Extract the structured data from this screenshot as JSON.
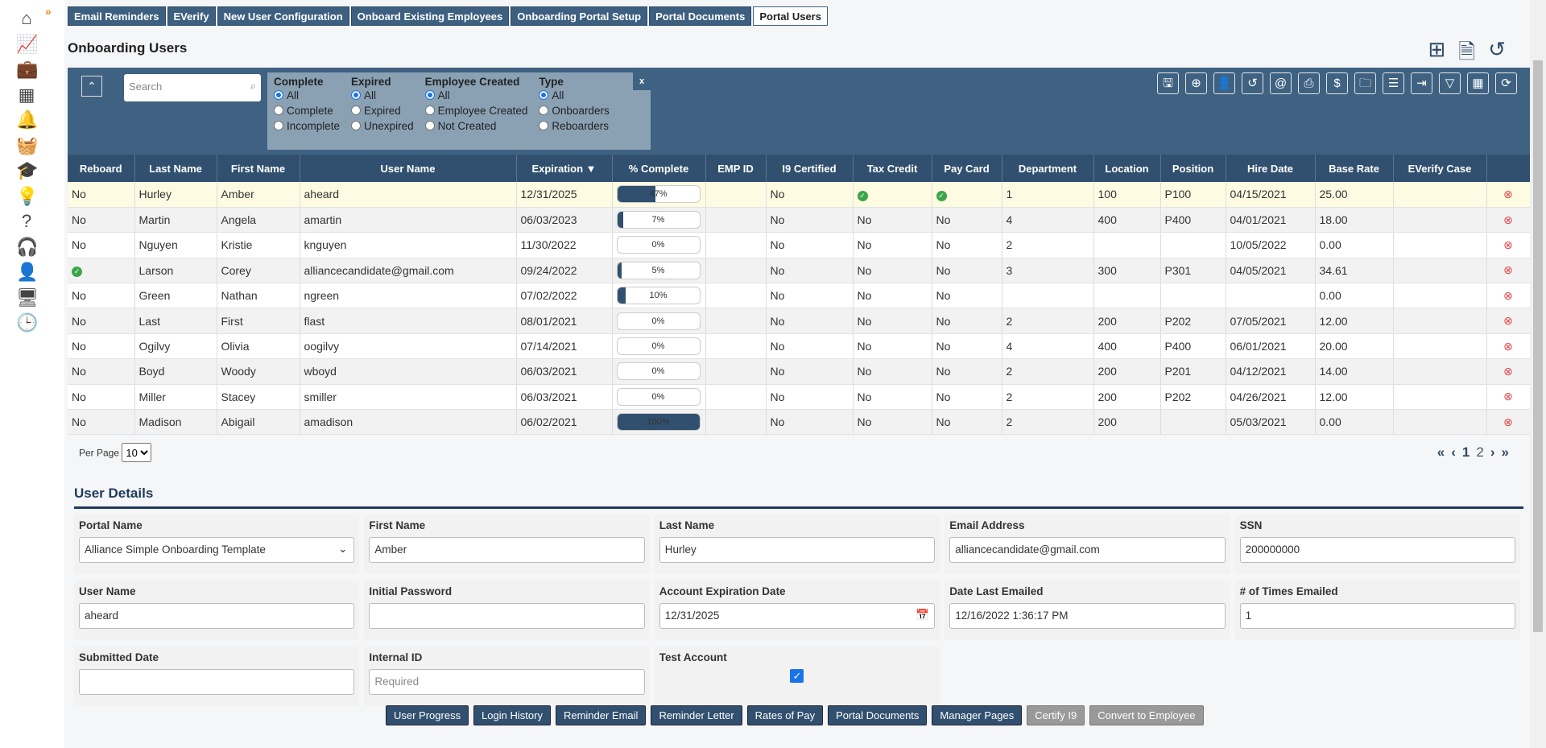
{
  "sidebar": {
    "icons": [
      "home-icon",
      "chart-icon",
      "briefcase-icon",
      "building-icon",
      "bell-icon",
      "basket-icon",
      "graduation-cap-icon",
      "lightbulb-icon",
      "help-icon",
      "headset-icon",
      "person-icon",
      "monitor-icon",
      "clock-icon"
    ],
    "glyphs": [
      "⌂",
      "📈",
      "💼",
      "▦",
      "🔔",
      "🧺",
      "🎓",
      "💡",
      "?",
      "🎧",
      "👤",
      "🖥",
      "🕒"
    ],
    "expand": "»"
  },
  "tabs": [
    "Email Reminders",
    "EVerify",
    "New User Configuration",
    "Onboard Existing Employees",
    "Onboarding Portal Setup",
    "Portal Documents",
    "Portal Users"
  ],
  "active_tab": "Portal Users",
  "page_title": "Onboarding Users",
  "search": {
    "placeholder": "Search"
  },
  "filters": [
    {
      "title": "Complete",
      "options": [
        "All",
        "Complete",
        "Incomplete"
      ],
      "selected": "All"
    },
    {
      "title": "Expired",
      "options": [
        "All",
        "Expired",
        "Unexpired"
      ],
      "selected": "All"
    },
    {
      "title": "Employee Created",
      "options": [
        "All",
        "Employee Created",
        "Not Created"
      ],
      "selected": "All"
    },
    {
      "title": "Type",
      "options": [
        "All",
        "Onboarders",
        "Reboarders"
      ],
      "selected": "All"
    }
  ],
  "filter_close": "x",
  "tools": [
    "save-icon",
    "add-icon",
    "user-card-icon",
    "history-icon",
    "email-at-icon",
    "pdf-icon",
    "invoice-icon",
    "folders-icon",
    "checklist-icon",
    "export-icon",
    "filter-icon",
    "grid-icon",
    "refresh-icon"
  ],
  "table": {
    "columns": [
      "Reboard",
      "Last Name",
      "First Name",
      "User Name",
      "Expiration ▼",
      "% Complete",
      "EMP ID",
      "I9 Certified",
      "Tax Credit",
      "Pay Card",
      "Department",
      "Location",
      "Position",
      "Hire Date",
      "Base Rate",
      "EVerify Case",
      ""
    ],
    "rows": [
      [
        "No",
        "Hurley",
        "Amber",
        "aheard",
        "12/31/2025",
        47,
        "",
        "No",
        "✓",
        "✓",
        "1",
        "100",
        "P100",
        "04/15/2021",
        "25.00",
        ""
      ],
      [
        "No",
        "Martin",
        "Angela",
        "amartin",
        "06/03/2023",
        7,
        "",
        "No",
        "No",
        "No",
        "4",
        "400",
        "P400",
        "04/01/2021",
        "18.00",
        ""
      ],
      [
        "No",
        "Nguyen",
        "Kristie",
        "knguyen",
        "11/30/2022",
        0,
        "",
        "No",
        "No",
        "No",
        "2",
        "",
        "",
        "10/05/2022",
        "0.00",
        ""
      ],
      [
        "✓",
        "Larson",
        "Corey",
        "alliancecandidate@gmail.com",
        "09/24/2022",
        5,
        "",
        "No",
        "No",
        "No",
        "3",
        "300",
        "P301",
        "04/05/2021",
        "34.61",
        ""
      ],
      [
        "No",
        "Green",
        "Nathan",
        "ngreen",
        "07/02/2022",
        10,
        "",
        "No",
        "No",
        "No",
        "",
        "",
        "",
        "",
        "0.00",
        ""
      ],
      [
        "No",
        "Last",
        "First",
        "flast",
        "08/01/2021",
        0,
        "",
        "No",
        "No",
        "No",
        "2",
        "200",
        "P202",
        "07/05/2021",
        "12.00",
        ""
      ],
      [
        "No",
        "Ogilvy",
        "Olivia",
        "oogilvy",
        "07/14/2021",
        0,
        "",
        "No",
        "No",
        "No",
        "4",
        "400",
        "P400",
        "06/01/2021",
        "20.00",
        ""
      ],
      [
        "No",
        "Boyd",
        "Woody",
        "wboyd",
        "06/03/2021",
        0,
        "",
        "No",
        "No",
        "No",
        "2",
        "200",
        "P201",
        "04/12/2021",
        "14.00",
        ""
      ],
      [
        "No",
        "Miller",
        "Stacey",
        "smiller",
        "06/03/2021",
        0,
        "",
        "No",
        "No",
        "No",
        "2",
        "200",
        "P202",
        "04/26/2021",
        "12.00",
        ""
      ],
      [
        "No",
        "Madison",
        "Abigail",
        "amadison",
        "06/02/2021",
        100,
        "",
        "No",
        "No",
        "No",
        "2",
        "200",
        "",
        "05/03/2021",
        "0.00",
        ""
      ]
    ]
  },
  "per_page": {
    "label": "Per Page",
    "value": "10"
  },
  "pager": {
    "first": "«",
    "prev": "‹",
    "current": "1",
    "next_page": "2",
    "next": "›",
    "last": "»"
  },
  "user_details": {
    "title": "User Details",
    "fields": [
      {
        "label": "Portal Name",
        "value": "Alliance Simple Onboarding Template",
        "type": "select"
      },
      {
        "label": "First Name",
        "value": "Amber"
      },
      {
        "label": "Last Name",
        "value": "Hurley"
      },
      {
        "label": "Email Address",
        "value": "alliancecandidate@gmail.com"
      },
      {
        "label": "SSN",
        "value": "200000000"
      },
      {
        "label": "User Name",
        "value": "aheard"
      },
      {
        "label": "Initial Password",
        "value": ""
      },
      {
        "label": "Account Expiration Date",
        "value": "12/31/2025",
        "type": "date"
      },
      {
        "label": "Date Last Emailed",
        "value": "12/16/2022 1:36:17 PM"
      },
      {
        "label": "# of Times Emailed",
        "value": "1"
      },
      {
        "label": "Submitted Date",
        "value": ""
      },
      {
        "label": "Internal ID",
        "value": "",
        "placeholder": "Required"
      },
      {
        "label": "Test Account",
        "value": true,
        "type": "checkbox"
      }
    ]
  },
  "buttons": [
    {
      "label": "User Progress",
      "enabled": true
    },
    {
      "label": "Login History",
      "enabled": true
    },
    {
      "label": "Reminder Email",
      "enabled": true
    },
    {
      "label": "Reminder Letter",
      "enabled": true
    },
    {
      "label": "Rates of Pay",
      "enabled": true
    },
    {
      "label": "Portal Documents",
      "enabled": true
    },
    {
      "label": "Manager Pages",
      "enabled": true
    },
    {
      "label": "Certify I9",
      "enabled": false
    },
    {
      "label": "Convert to Employee",
      "enabled": false
    }
  ]
}
